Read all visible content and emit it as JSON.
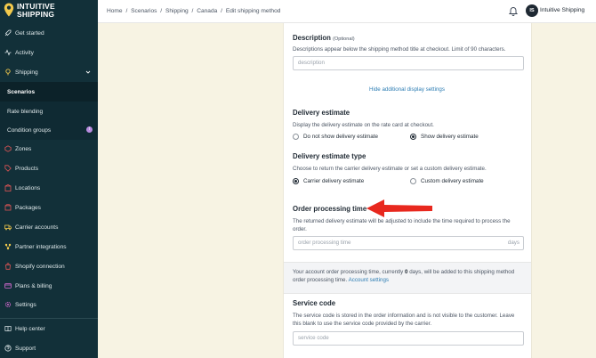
{
  "brand": {
    "line1": "INTUITIVE",
    "line2": "SHIPPING"
  },
  "sidebar": {
    "items": [
      {
        "label": "Get started",
        "icon": "rocket-icon"
      },
      {
        "label": "Activity",
        "icon": "activity-icon"
      },
      {
        "label": "Shipping",
        "icon": "shipping-icon"
      },
      {
        "label": "Zones",
        "icon": "zones-icon"
      },
      {
        "label": "Products",
        "icon": "tag-icon"
      },
      {
        "label": "Locations",
        "icon": "building-icon"
      },
      {
        "label": "Packages",
        "icon": "box-icon"
      },
      {
        "label": "Carrier accounts",
        "icon": "truck-icon"
      },
      {
        "label": "Partner integrations",
        "icon": "integration-icon"
      },
      {
        "label": "Shopify connection",
        "icon": "shopify-icon"
      },
      {
        "label": "Plans & billing",
        "icon": "card-icon"
      },
      {
        "label": "Settings",
        "icon": "gear-icon"
      },
      {
        "label": "Help center",
        "icon": "book-icon"
      },
      {
        "label": "Support",
        "icon": "help-icon"
      }
    ],
    "sub": [
      {
        "label": "Scenarios"
      },
      {
        "label": "Rate blending"
      },
      {
        "label": "Condition groups"
      }
    ]
  },
  "topbar": {
    "crumbs": [
      "Home",
      "/",
      "Scenarios",
      "/",
      "Shipping",
      "/",
      "Canada",
      "/",
      "Edit shipping method"
    ],
    "avatar": "IS",
    "account": "Intuitive Shipping"
  },
  "form": {
    "description_title": "Description",
    "description_optional": "(Optional)",
    "description_help": "Descriptions appear below the shipping method title at checkout. Limit of 90 characters.",
    "description_placeholder": "description",
    "hide_link": "Hide additional display settings",
    "estimate_title": "Delivery estimate",
    "estimate_help": "Display the delivery estimate on the rate card at checkout.",
    "estimate_opt1": "Do not show delivery estimate",
    "estimate_opt2": "Show delivery estimate",
    "estimate_type_title": "Delivery estimate type",
    "estimate_type_help": "Choose to return the carrier delivery estimate or set a custom delivery estimate.",
    "estimate_type_opt1": "Carrier delivery estimate",
    "estimate_type_opt2": "Custom delivery estimate",
    "processing_title": "Order processing time",
    "processing_help1": "The returned delivery estimate will be adjusted to include the time required to process the",
    "processing_help2": "order.",
    "processing_placeholder": "order processing time",
    "processing_suffix": "days",
    "note_1": "Your account order processing time, currently",
    "note_value": "0",
    "note_2": "days, will be added to this shipping method",
    "note_3": "order processing time.",
    "note_link": "Account settings",
    "service_title": "Service code",
    "service_help1": "The service code is stored in the order information and is not visible to the customer. Leave",
    "service_help2": "this blank to use the service code provided by the carrier.",
    "service_placeholder": "service code"
  },
  "colors": {
    "sidebar": "#123039",
    "page": "#f7f3e3",
    "link": "#2d7db3",
    "arrow": "#e8281e",
    "badge": "#b88ce0"
  }
}
